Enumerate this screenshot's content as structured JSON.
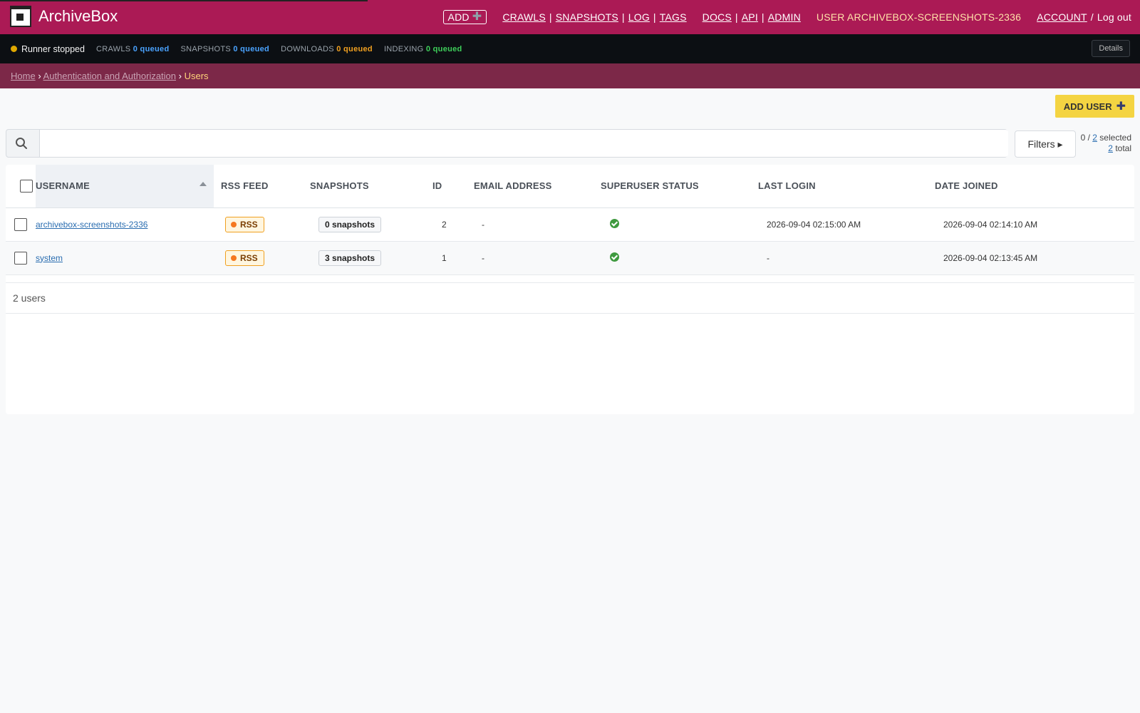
{
  "header": {
    "brand": "ArchiveBox",
    "add_label": "ADD",
    "nav_left": [
      "CRAWLS",
      "SNAPSHOTS",
      "LOG",
      "TAGS"
    ],
    "nav_mid": [
      "DOCS",
      "API",
      "ADMIN"
    ],
    "user_label": "USER ARCHIVEBOX-SCREENSHOTS-2336",
    "account_label": "ACCOUNT",
    "logout_label": "Log out",
    "bg_color": "#ab1a55"
  },
  "status": {
    "runner": "Runner stopped",
    "crawls_label": "CRAWLS",
    "crawls_value": "0 queued",
    "snapshots_label": "SNAPSHOTS",
    "snapshots_value": "0 queued",
    "downloads_label": "DOWNLOADS",
    "downloads_value": "0 queued",
    "indexing_label": "INDEXING",
    "indexing_value": "0 queued",
    "details_label": "Details"
  },
  "breadcrumbs": {
    "home": "Home",
    "section": "Authentication and Authorization",
    "current": "Users"
  },
  "toolbar": {
    "add_user_label": "ADD USER",
    "search_value": "",
    "filters_label": "Filters ▸",
    "selected_prefix": "0 / ",
    "selected_count": "2",
    "selected_suffix": " selected",
    "total_count": "2",
    "total_suffix": " total"
  },
  "table": {
    "columns": [
      "USERNAME",
      "RSS FEED",
      "SNAPSHOTS",
      "ID",
      "EMAIL ADDRESS",
      "SUPERUSER STATUS",
      "LAST LOGIN",
      "DATE JOINED"
    ],
    "rows": [
      {
        "username": "archivebox-screenshots-2336",
        "rss": "RSS",
        "snapshots": "0 snapshots",
        "id": "2",
        "email": "-",
        "last_login": "2026-09-04 02:15:00 AM",
        "date_joined": "2026-09-04 02:14:10 AM"
      },
      {
        "username": "system",
        "rss": "RSS",
        "snapshots": "3 snapshots",
        "id": "1",
        "email": "-",
        "last_login": "-",
        "date_joined": "2026-09-04 02:13:45 AM"
      }
    ],
    "count_label": "2 users"
  }
}
